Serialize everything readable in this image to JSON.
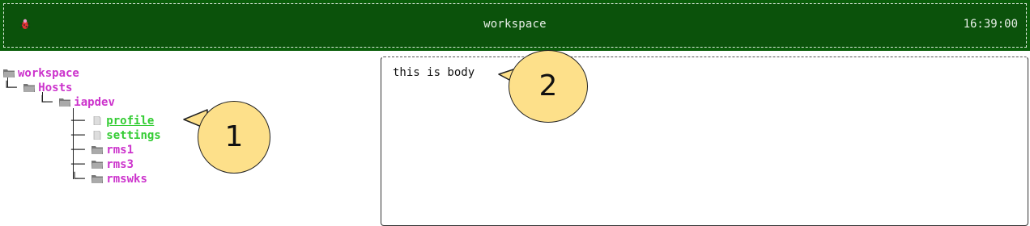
{
  "header": {
    "title": "workspace",
    "time": "16:39:00",
    "icon": "bug-icon"
  },
  "tree": {
    "root": "workspace",
    "hosts": "Hosts",
    "iapdev": "iapdev",
    "children": [
      {
        "label": "profile",
        "type": "file"
      },
      {
        "label": "settings",
        "type": "file"
      },
      {
        "label": "rms1",
        "type": "folder"
      },
      {
        "label": "rms3",
        "type": "folder"
      },
      {
        "label": "rmswks",
        "type": "folder"
      }
    ]
  },
  "body": {
    "text": "this is body"
  },
  "callouts": {
    "one": "1",
    "two": "2"
  },
  "colors": {
    "header_bg": "#0b520b",
    "folder": "#cc33cc",
    "file": "#33cc33",
    "callout": "#fde08a"
  }
}
